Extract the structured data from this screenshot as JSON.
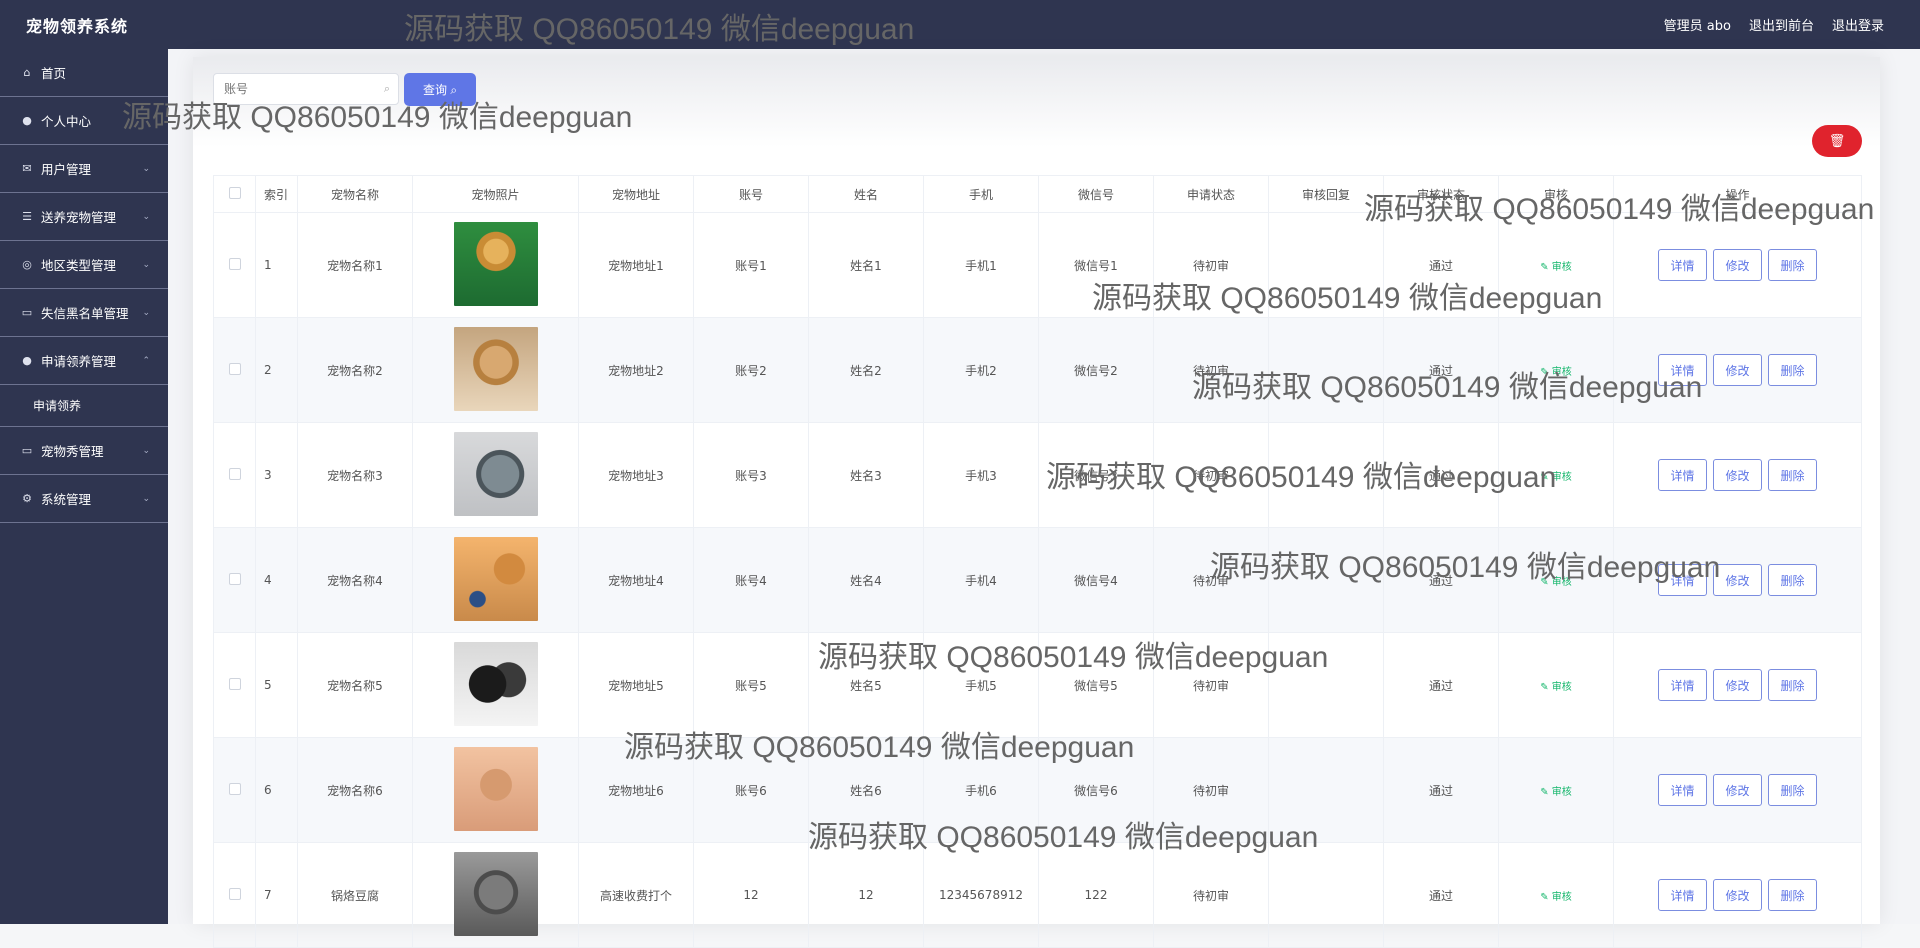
{
  "topbar": {
    "title": "宠物领养系统",
    "admin": "管理员 abo",
    "front": "退出到前台",
    "logout": "退出登录"
  },
  "sidebar": {
    "items": [
      {
        "label": "首页",
        "icon": "home-icon"
      },
      {
        "label": "个人中心",
        "icon": "user-icon"
      },
      {
        "label": "用户管理",
        "icon": "mail-icon"
      },
      {
        "label": "送养宠物管理",
        "icon": "list-icon"
      },
      {
        "label": "地区类型管理",
        "icon": "target-icon"
      },
      {
        "label": "失信黑名单管理",
        "icon": "monitor-icon"
      },
      {
        "label": "申请领养管理",
        "icon": "user-icon"
      },
      {
        "label": "宠物秀管理",
        "icon": "monitor-icon"
      },
      {
        "label": "系统管理",
        "icon": "settings-icon"
      }
    ],
    "submenu": "申请领养"
  },
  "search": {
    "placeholder": "账号",
    "button": "查询"
  },
  "delete_icon": "trash-icon",
  "table": {
    "headers": [
      "",
      "索引",
      "宠物名称",
      "宠物照片",
      "宠物地址",
      "账号",
      "姓名",
      "手机",
      "微信号",
      "申请状态",
      "审核回复",
      "审核状态",
      "审核",
      "操作"
    ],
    "rows": [
      {
        "index": "1",
        "name": "宠物名称1",
        "address": "宠物地址1",
        "account": "账号1",
        "person": "姓名1",
        "phone": "手机1",
        "wechat": "微信号1",
        "status": "待初审",
        "reply": "",
        "audit": "通过",
        "review": "审核"
      },
      {
        "index": "2",
        "name": "宠物名称2",
        "address": "宠物地址2",
        "account": "账号2",
        "person": "姓名2",
        "phone": "手机2",
        "wechat": "微信号2",
        "status": "待初审",
        "reply": "",
        "audit": "通过",
        "review": "审核"
      },
      {
        "index": "3",
        "name": "宠物名称3",
        "address": "宠物地址3",
        "account": "账号3",
        "person": "姓名3",
        "phone": "手机3",
        "wechat": "微信号3",
        "status": "待初审",
        "reply": "",
        "audit": "通过",
        "review": "审核"
      },
      {
        "index": "4",
        "name": "宠物名称4",
        "address": "宠物地址4",
        "account": "账号4",
        "person": "姓名4",
        "phone": "手机4",
        "wechat": "微信号4",
        "status": "待初审",
        "reply": "",
        "audit": "通过",
        "review": "审核"
      },
      {
        "index": "5",
        "name": "宠物名称5",
        "address": "宠物地址5",
        "account": "账号5",
        "person": "姓名5",
        "phone": "手机5",
        "wechat": "微信号5",
        "status": "待初审",
        "reply": "",
        "audit": "通过",
        "review": "审核"
      },
      {
        "index": "6",
        "name": "宠物名称6",
        "address": "宠物地址6",
        "account": "账号6",
        "person": "姓名6",
        "phone": "手机6",
        "wechat": "微信号6",
        "status": "待初审",
        "reply": "",
        "audit": "通过",
        "review": "审核"
      },
      {
        "index": "7",
        "name": "锅烙豆腐",
        "address": "高速收费打个",
        "account": "12",
        "person": "12",
        "phone": "12345678912",
        "wechat": "122",
        "status": "待初审",
        "reply": "",
        "audit": "通过",
        "review": "审核"
      }
    ],
    "actions": {
      "detail": "详情",
      "edit": "修改",
      "delete": "删除"
    }
  },
  "watermark": "源码获取 QQ86050149 微信deepguan"
}
